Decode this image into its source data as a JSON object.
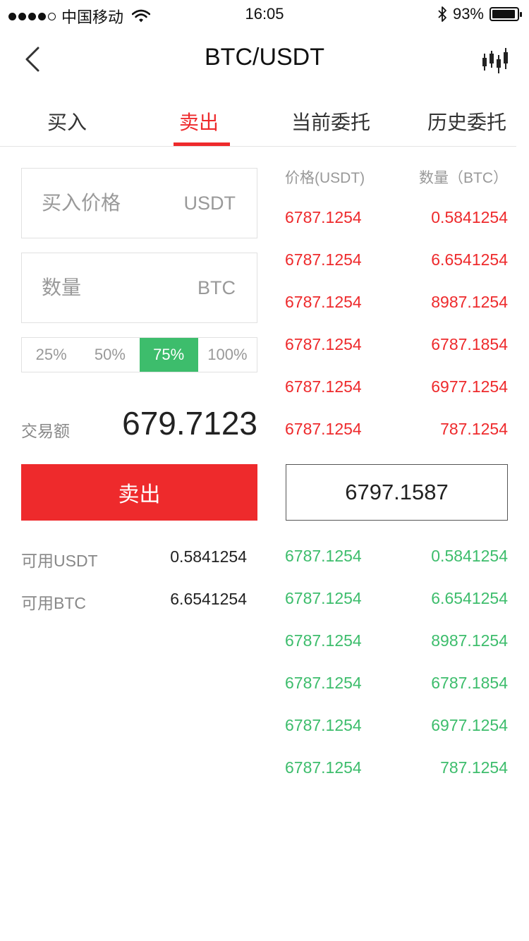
{
  "status_bar": {
    "carrier": "中国移动",
    "time": "16:05",
    "battery": "93%",
    "battery_level": 0.93
  },
  "header": {
    "title": "BTC/USDT",
    "back_icon": "chevron-left-icon",
    "chart_icon": "candlestick-chart-icon"
  },
  "tabs": [
    "买入",
    "卖出",
    "当前委托",
    "历史委托"
  ],
  "active_tab": 1,
  "form": {
    "price_placeholder": "买入价格",
    "price_unit": "USDT",
    "qty_placeholder": "数量",
    "qty_unit": "BTC",
    "percents": [
      "25%",
      "50%",
      "75%",
      "100%"
    ],
    "active_percent": 2,
    "amount_label": "交易额",
    "amount_value": "679.7123",
    "submit_label": "卖出",
    "available": [
      {
        "label": "可用USDT",
        "value": "0.5841254"
      },
      {
        "label": "可用BTC",
        "value": "6.6541254"
      }
    ]
  },
  "orderbook": {
    "price_header": "价格(USDT)",
    "qty_header": "数量（BTC）",
    "asks": [
      {
        "price": "6787.1254",
        "qty": "0.5841254"
      },
      {
        "price": "6787.1254",
        "qty": "6.6541254"
      },
      {
        "price": "6787.1254",
        "qty": "8987.1254"
      },
      {
        "price": "6787.1254",
        "qty": "6787.1854"
      },
      {
        "price": "6787.1254",
        "qty": "6977.1254"
      },
      {
        "price": "6787.1254",
        "qty": "787.1254"
      }
    ],
    "last_price": "6797.1587",
    "bids": [
      {
        "price": "6787.1254",
        "qty": "0.5841254"
      },
      {
        "price": "6787.1254",
        "qty": "6.6541254"
      },
      {
        "price": "6787.1254",
        "qty": "8987.1254"
      },
      {
        "price": "6787.1254",
        "qty": "6787.1854"
      },
      {
        "price": "6787.1254",
        "qty": "6977.1254"
      },
      {
        "price": "6787.1254",
        "qty": "787.1254"
      }
    ]
  },
  "colors": {
    "accent_red": "#ee2a2c",
    "accent_green": "#3dbd6c"
  }
}
